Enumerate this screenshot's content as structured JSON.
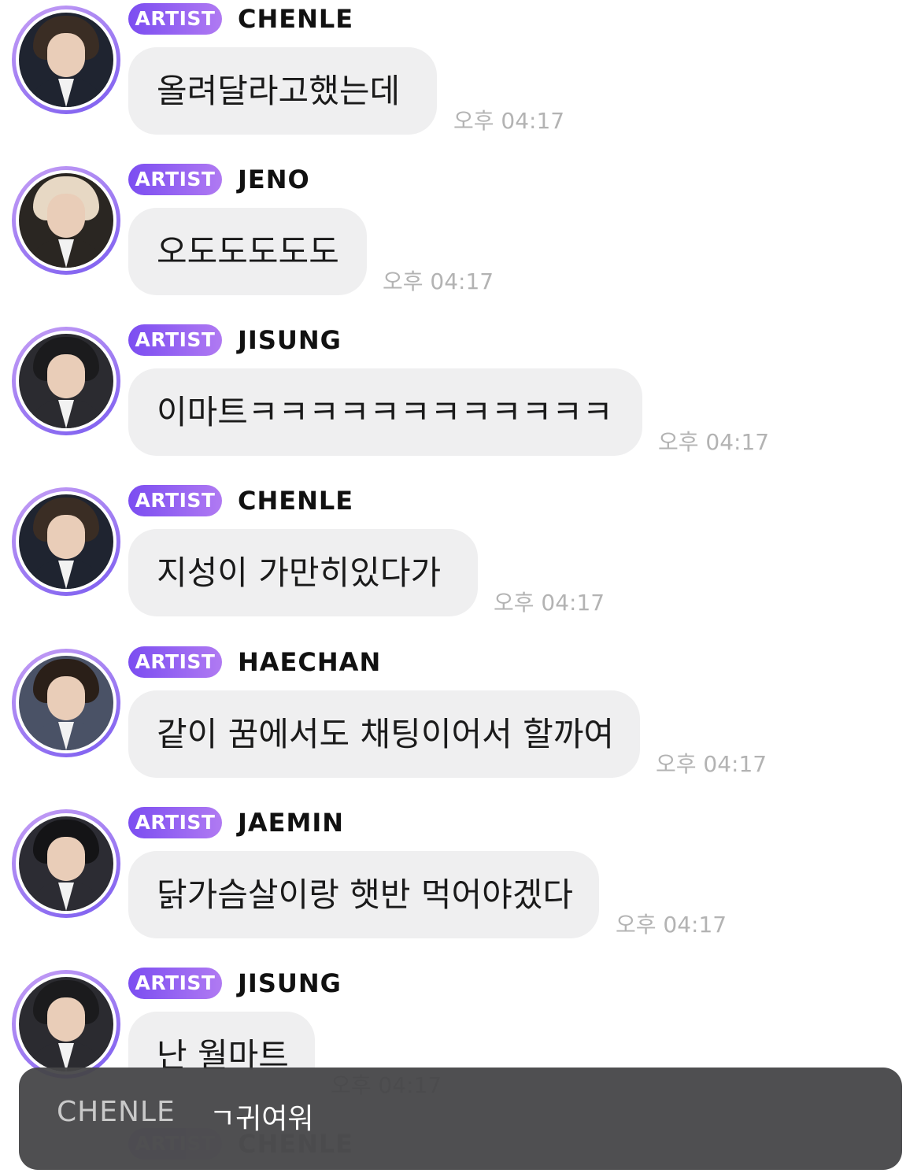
{
  "messages": [
    {
      "badge": "ARTIST",
      "sender": "CHENLE",
      "text": "올려달라고했는데",
      "time": "오후 04:17",
      "avatar_colors": [
        "#3a2d24",
        "#1f2430"
      ]
    },
    {
      "badge": "ARTIST",
      "sender": "JENO",
      "text": "오도도도도도",
      "time": "오후 04:17",
      "avatar_colors": [
        "#e7d8c4",
        "#2a2622"
      ]
    },
    {
      "badge": "ARTIST",
      "sender": "JISUNG",
      "text": "이마트ㅋㅋㅋㅋㅋㅋㅋㅋㅋㅋㅋㅋ",
      "time": "오후 04:17",
      "avatar_colors": [
        "#1b1b1d",
        "#2b2b30"
      ]
    },
    {
      "badge": "ARTIST",
      "sender": "CHENLE",
      "text": "지성이 가만히있다가",
      "time": "오후 04:17",
      "avatar_colors": [
        "#3a2d24",
        "#1f2430"
      ]
    },
    {
      "badge": "ARTIST",
      "sender": "HAECHAN",
      "text": "같이 꿈에서도 채팅이어서 할까여",
      "time": "오후 04:17",
      "avatar_colors": [
        "#2a1f18",
        "#4a5266"
      ]
    },
    {
      "badge": "ARTIST",
      "sender": "JAEMIN",
      "text": "닭가슴살이랑 햇반 먹어야겠다",
      "time": "오후 04:17",
      "avatar_colors": [
        "#141416",
        "#2c2c33"
      ]
    },
    {
      "badge": "ARTIST",
      "sender": "JISUNG",
      "text": "난 월마트",
      "time": "오후 04:17",
      "avatar_colors": [
        "#1b1b1d",
        "#2b2b30"
      ]
    },
    {
      "badge": "ARTIST",
      "sender": "CHENLE",
      "text": "",
      "time": "",
      "avatar_colors": [
        "#3a2d24",
        "#1f2430"
      ]
    }
  ],
  "toast": {
    "sender": "CHENLE",
    "text": "ㄱ귀여워"
  }
}
